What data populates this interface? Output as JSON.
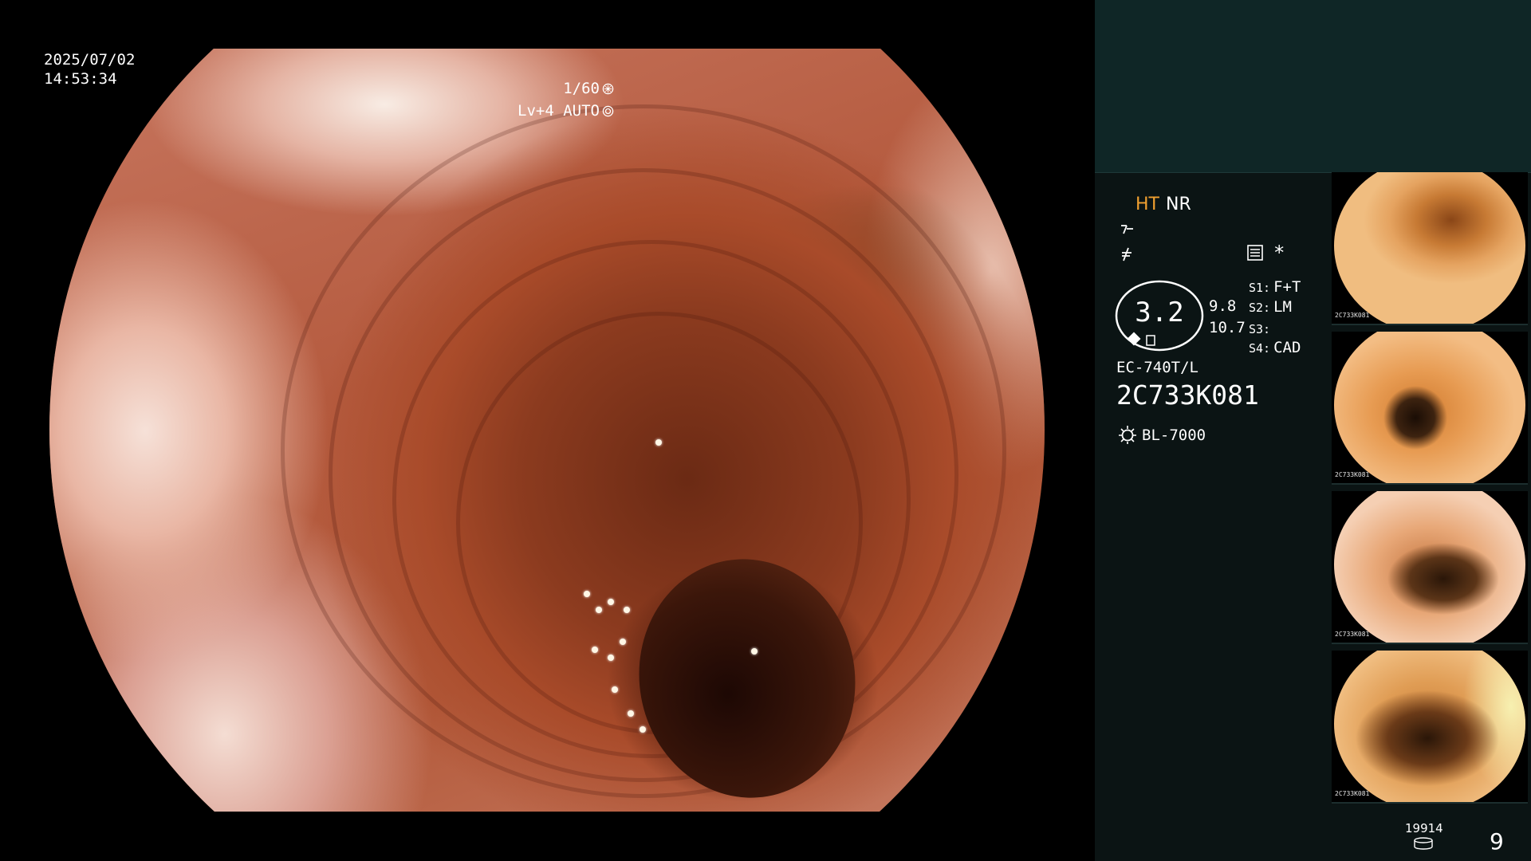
{
  "osd": {
    "date": "2025/07/02",
    "time": "14:53:34",
    "shutter": "1/60",
    "level": "Lv+4 AUTO"
  },
  "panel": {
    "ht": "HT",
    "nr": "NR",
    "gauge_value": "3.2",
    "value_top": "9.8",
    "value_bottom": "10.7",
    "star": "*",
    "switches": [
      {
        "key": "S1:",
        "value": "F+T"
      },
      {
        "key": "S2:",
        "value": "LM"
      },
      {
        "key": "S3:",
        "value": ""
      },
      {
        "key": "S4:",
        "value": "CAD"
      }
    ],
    "scope_model": "EC-740T/L",
    "scope_serial": "2C733K081",
    "light_source": "BL-7000"
  },
  "thumbnails": [
    {
      "label": "2C733K081"
    },
    {
      "label": "2C733K081"
    },
    {
      "label": "2C733K081"
    },
    {
      "label": "2C733K081"
    }
  ],
  "footer": {
    "image_count": "19914",
    "page": "9"
  },
  "colors": {
    "background": "#000000",
    "panel": "#0b1414",
    "panel_top": "#0f2626",
    "ht_accent": "#f0a030"
  },
  "icons": [
    "shutter-icon",
    "iris-icon",
    "sharpness-icon",
    "enhance-icon",
    "list-icon",
    "light-source-icon",
    "disk-icon"
  ]
}
